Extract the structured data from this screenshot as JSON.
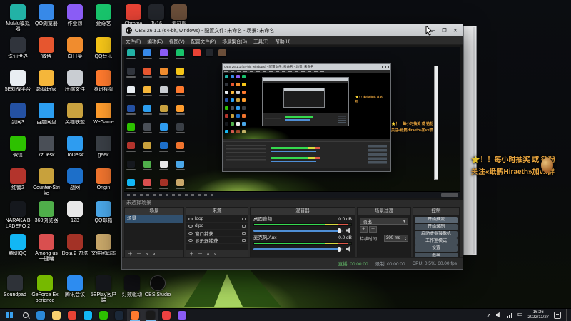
{
  "desktop": {
    "icons": [
      {
        "label": "MuMu模拟器",
        "color": "#22b2a6"
      },
      {
        "label": "诛仙世界",
        "color": "#30343c"
      },
      {
        "label": "5E对战平台",
        "color": "#e9eef2"
      },
      {
        "label": "剑网3",
        "color": "#2451a3"
      },
      {
        "label": "微信",
        "color": "#2dc100"
      },
      {
        "label": "红警2",
        "color": "#b3342c"
      },
      {
        "label": "NARAKA BLADEPO 2018101..",
        "color": "#15181d"
      },
      {
        "label": "腾讯QQ",
        "color": "#12b7f5"
      },
      {
        "label": "QQ浏览器",
        "color": "#3789e8"
      },
      {
        "label": "微博",
        "color": "#e6562f"
      },
      {
        "label": "超级玩家",
        "color": "#f5b63a"
      },
      {
        "label": "百度网盘",
        "color": "#2c9ef0"
      },
      {
        "label": "7zDesk",
        "color": "#4a4f57"
      },
      {
        "label": "Counter-Strike",
        "color": "#c8a13c"
      },
      {
        "label": "360浏览器",
        "color": "#4fae4a"
      },
      {
        "label": "Among us一键端",
        "color": "#d94f4f"
      },
      {
        "label": "作业帮",
        "color": "#8a5cf5"
      },
      {
        "label": "向日葵",
        "color": "#f08c2e"
      },
      {
        "label": "压缩文件",
        "color": "#c9cdd2"
      },
      {
        "label": "英雄联盟",
        "color": "#c9a23f"
      },
      {
        "label": "ToDesk",
        "color": "#2e9cf0"
      },
      {
        "label": "战网",
        "color": "#1d6fc9"
      },
      {
        "label": "123",
        "color": "#e8e8e8"
      },
      {
        "label": "Dota 2 刀塔",
        "color": "#a33226"
      },
      {
        "label": "爱奇艺",
        "color": "#18c36b"
      },
      {
        "label": "QQ音乐",
        "color": "#f5c518"
      },
      {
        "label": "腾讯视频",
        "color": "#ff7a2e"
      },
      {
        "label": "WeGame",
        "color": "#ff9d2e"
      },
      {
        "label": "geek",
        "color": "#3a3f46"
      },
      {
        "label": "Origin",
        "color": "#f0742e"
      },
      {
        "label": "QQ邮箱",
        "color": "#4aa7e8"
      },
      {
        "label": "文件密码本",
        "color": "#c9a86a"
      }
    ],
    "extra_icons": [
      {
        "label": "Chrome",
        "color": "#e84335"
      },
      {
        "label": "JV16",
        "color": "#23262c"
      },
      {
        "label": "素材图",
        "color": "#6b4f3a"
      }
    ],
    "bottom_icons": [
      {
        "label": "Soundpad",
        "color": "#2e3238"
      },
      {
        "label": "GeForce Experience",
        "color": "#76b900"
      },
      {
        "label": "腾讯会议",
        "color": "#2d8cf0"
      },
      {
        "label": "5EPlay客户端",
        "color": "#15171b"
      },
      {
        "label": "灯效驱动",
        "color": "#101014"
      },
      {
        "label": "OBS Studio",
        "color": "#0d0d0d",
        "round": true
      }
    ],
    "overlay": {
      "line1": "⭐！！每小时抽奖 或 钻粉",
      "line2": "关注«纸鹤Hiraeth»加vx群",
      "accent_color": "#eda83f"
    }
  },
  "obs": {
    "title": "OBS 26.1.1 (64-bit, windows) - 配置文件: 未命名 - 场景: 未命名",
    "window_buttons": {
      "minimize": "─",
      "maximize": "❐",
      "close": "✕"
    },
    "menus": [
      "文件(F)",
      "编辑(E)",
      "视图(V)",
      "配置文件(P)",
      "场景集合(S)",
      "工具(T)",
      "帮助(H)"
    ],
    "no_scene_label": "未选择场景",
    "docks": {
      "scenes": {
        "title": "场景",
        "items": [
          "场景"
        ]
      },
      "sources": {
        "title": "来源",
        "items": [
          "loop",
          "dipo",
          "窗口捕获",
          "显示器捕获"
        ]
      },
      "mixer": {
        "title": "混音器",
        "channels": [
          {
            "name": "桌面音频",
            "db": "0.0 dB"
          },
          {
            "name": "麦克风/Aux",
            "db": "0.0 dB"
          }
        ]
      },
      "transitions": {
        "title": "场景过渡",
        "selected": "淡出",
        "duration_label": "持续时间",
        "duration_value": "300 ms"
      },
      "controls": {
        "title": "控制",
        "buttons": [
          "开始推流",
          "开始录制",
          "启动虚拟摄像机",
          "工作室模式",
          "设置",
          "退出"
        ]
      }
    },
    "toolbar_icons": {
      "plus": "＋",
      "minus": "－",
      "up": "∧",
      "down": "∨",
      "dropdown": "▾",
      "spin_up": "▴",
      "spin_down": "▾"
    },
    "status": {
      "stream": "直播: 00:00:00",
      "rec": "录制: 00:00:00",
      "cpu": "CPU: 0.5%, 60.00 fps"
    }
  },
  "taskbar": {
    "apps": [
      {
        "name": "edge",
        "color": "#2b88d8"
      },
      {
        "name": "folder",
        "color": "#f8d070"
      },
      {
        "name": "chrome",
        "color": "#e84335"
      },
      {
        "name": "qq",
        "color": "#12b7f5"
      },
      {
        "name": "wechat",
        "color": "#2dc100"
      },
      {
        "name": "steam",
        "color": "#1b2838"
      },
      {
        "name": "wegame",
        "color": "#ff7a2e",
        "open": true
      },
      {
        "name": "obs",
        "color": "#1a1a1a",
        "open": true
      },
      {
        "name": "music",
        "color": "#ec4141"
      },
      {
        "name": "game",
        "color": "#8a5cf5"
      }
    ],
    "tray": {
      "ime": "中",
      "time": "16:26",
      "date": "2022/11/27"
    }
  }
}
